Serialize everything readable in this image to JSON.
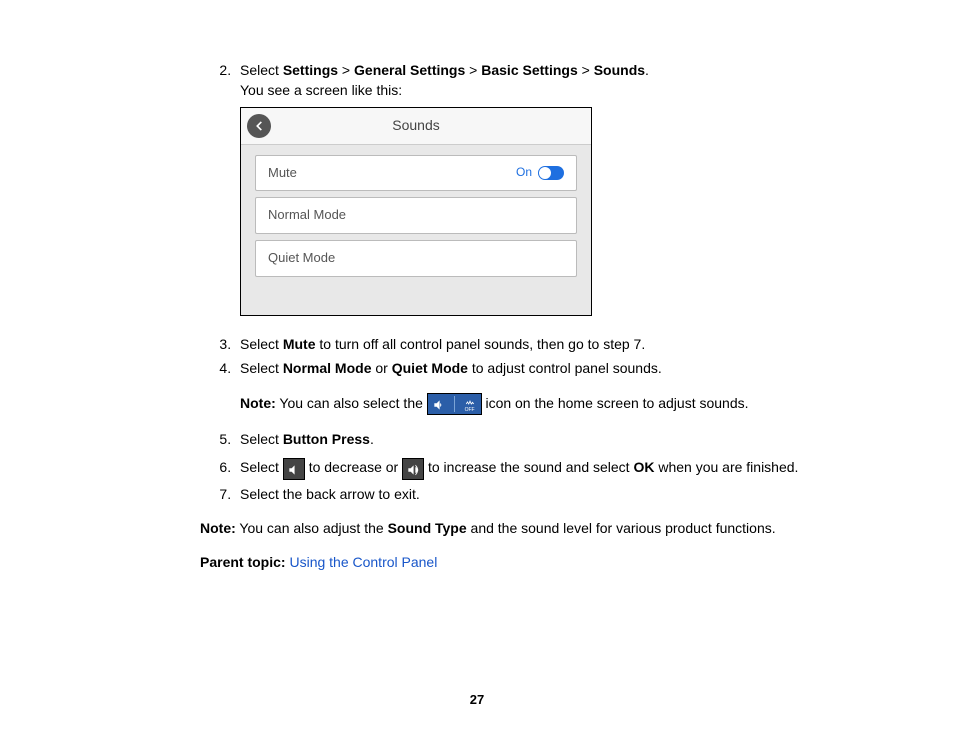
{
  "step2": {
    "num": "2.",
    "prefix": "Select ",
    "b1": "Settings",
    "s1": " > ",
    "b2": "General Settings",
    "s2": " > ",
    "b3": "Basic Settings",
    "s3": " > ",
    "b4": "Sounds",
    "suffix": ".",
    "sub": "You see a screen like this:"
  },
  "screenshot": {
    "title": "Sounds",
    "row_mute": "Mute",
    "row_mute_state": "On",
    "row_normal": "Normal Mode",
    "row_quiet": "Quiet Mode"
  },
  "step3": {
    "prefix": "Select ",
    "b1": "Mute",
    "suffix": " to turn off all control panel sounds, then go to step 7."
  },
  "step4": {
    "prefix": "Select ",
    "b1": "Normal Mode",
    "mid": " or ",
    "b2": "Quiet Mode",
    "suffix": " to adjust control panel sounds."
  },
  "note1": {
    "label": "Note:",
    "before": " You can also select the ",
    "after": " icon on the home screen to adjust sounds.",
    "off": "OFF"
  },
  "step5": {
    "prefix": "Select ",
    "b1": "Button Press",
    "suffix": "."
  },
  "step6": {
    "prefix": "Select ",
    "mid1": " to decrease or ",
    "mid2": " to increase the sound and select ",
    "b1": "OK",
    "suffix": " when you are finished."
  },
  "step7": {
    "text": "Select the back arrow to exit."
  },
  "note2": {
    "label": "Note:",
    "before": " You can also adjust the ",
    "b1": "Sound Type",
    "after": " and the sound level for various product functions."
  },
  "parent": {
    "label": "Parent topic:",
    "link": " Using the Control Panel"
  },
  "pagenum": "27"
}
